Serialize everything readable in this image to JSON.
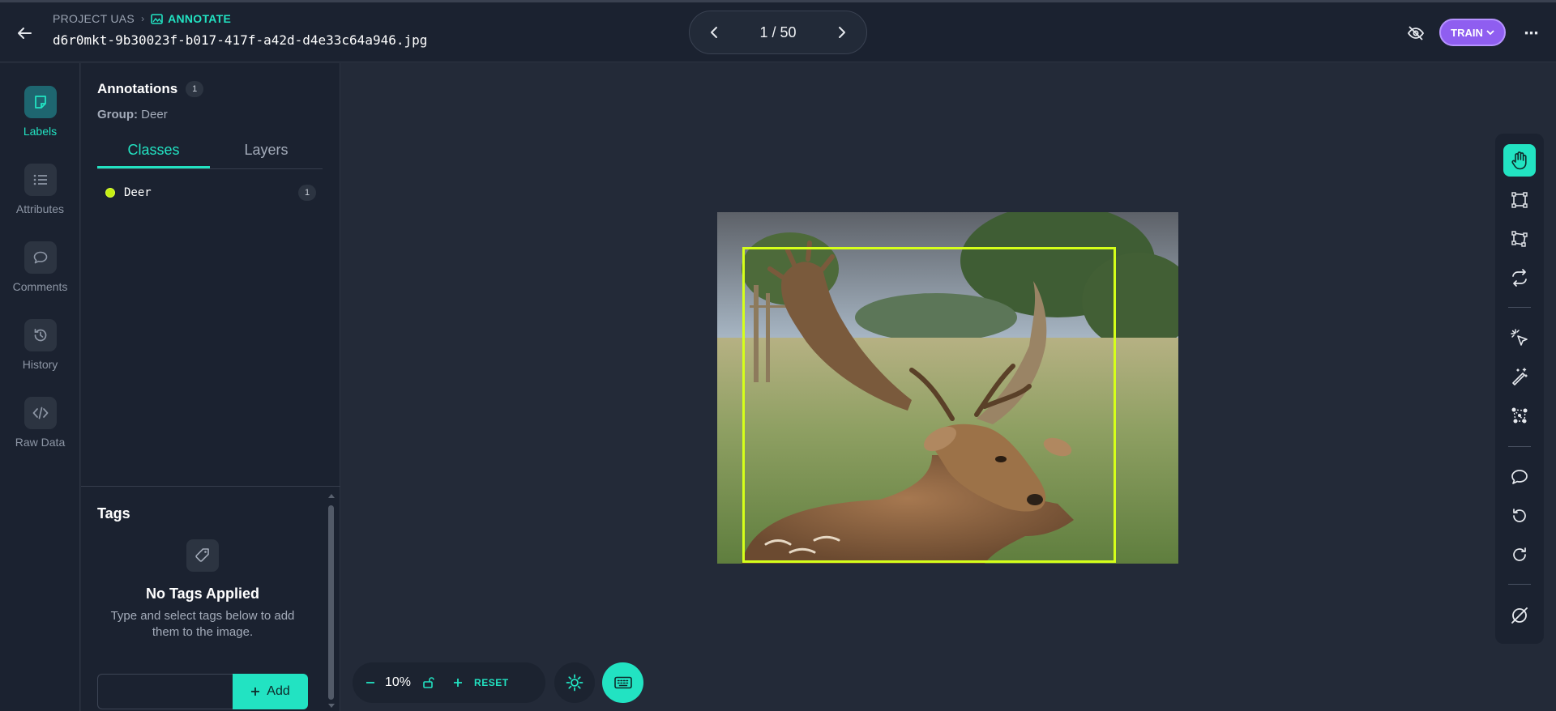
{
  "header": {
    "breadcrumb_project": "PROJECT UAS",
    "breadcrumb_annotate": "ANNOTATE",
    "file_name": "d6r0mkt-9b30023f-b017-417f-a42d-d4e33c64a946.jpg",
    "pager_text": "1 / 50",
    "train_label": "TRAIN"
  },
  "leftnav": {
    "items": [
      {
        "label": "Labels",
        "icon": "label-icon",
        "active": true
      },
      {
        "label": "Attributes",
        "icon": "list-icon"
      },
      {
        "label": "Comments",
        "icon": "comment-icon"
      },
      {
        "label": "History",
        "icon": "history-icon"
      },
      {
        "label": "Raw Data",
        "icon": "code-icon"
      }
    ]
  },
  "panel": {
    "annotations_title": "Annotations",
    "annotations_count": "1",
    "group_label": "Group:",
    "group_value": "Deer",
    "tabs": [
      {
        "label": "Classes",
        "active": true
      },
      {
        "label": "Layers"
      }
    ],
    "classes": [
      {
        "name": "Deer",
        "count": "1",
        "color": "#c6ef12"
      }
    ],
    "tags_title": "Tags",
    "no_tags_title": "No Tags Applied",
    "no_tags_desc": "Type and select tags below to add them to the image.",
    "tag_input_value": "",
    "add_label": "Add"
  },
  "canvas": {
    "zoom": "10%",
    "reset_label": "RESET",
    "bbox_color": "#d5ff1a"
  },
  "toolbar": {
    "tools": [
      "pan-hand-icon",
      "bounding-box-icon",
      "polygon-icon",
      "transform-icon",
      "magic-select-icon",
      "magic-wand-icon",
      "keypoints-icon",
      "comment-icon",
      "undo-icon",
      "redo-icon",
      "clear-icon"
    ],
    "active_tool": "pan-hand-icon"
  },
  "colors": {
    "accent": "#22e3c2",
    "train": "#8f5ef0"
  }
}
